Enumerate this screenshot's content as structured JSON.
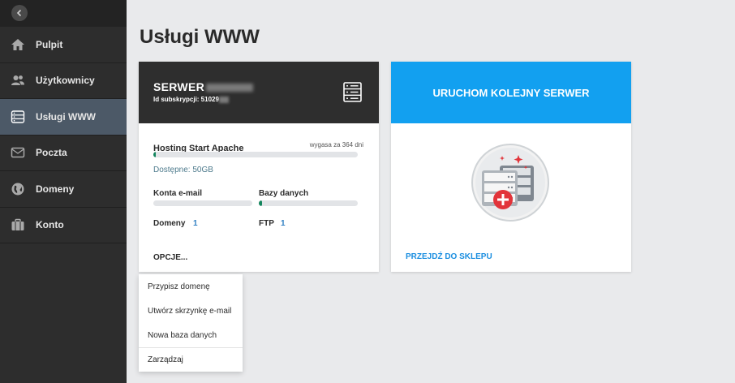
{
  "sidebar": {
    "items": [
      {
        "label": "Pulpit",
        "icon": "home-icon"
      },
      {
        "label": "Użytkownicy",
        "icon": "users-icon"
      },
      {
        "label": "Usługi WWW",
        "icon": "server-icon",
        "active": true
      },
      {
        "label": "Poczta",
        "icon": "mail-icon"
      },
      {
        "label": "Domeny",
        "icon": "globe-icon"
      },
      {
        "label": "Konto",
        "icon": "briefcase-icon"
      }
    ]
  },
  "page": {
    "title": "Usługi WWW"
  },
  "server_card": {
    "name": "SERWER",
    "subscription_label": "Id subskrypcji: 51029",
    "plan_name": "Hosting Start Apache",
    "expires": "wygasa za 364 dni",
    "plan_usage": 0.01,
    "available": "Dostępne: 50GB",
    "email_accounts_label": "Konta e-mail",
    "email_accounts_usage": 0,
    "databases_label": "Bazy danych",
    "databases_usage": 0.02,
    "domains_label": "Domeny",
    "domains_count": "1",
    "ftp_label": "FTP",
    "ftp_count": "1",
    "options_label": "OPCJE..."
  },
  "options_menu": {
    "items": [
      "Przypisz domenę",
      "Utwórz skrzynkę e-mail",
      "Nowa baza danych",
      "Zarządzaj"
    ]
  },
  "shop_card": {
    "title": "URUCHOM KOLEJNY SERWER",
    "link": "PRZEJDŹ DO SKLEPU"
  },
  "colors": {
    "sidebar": "#2d2d2d",
    "sidebar_active": "#4c5967",
    "accent_blue": "#12a0f0",
    "progress_green": "#13855d",
    "link_blue": "#2f7fc3"
  }
}
